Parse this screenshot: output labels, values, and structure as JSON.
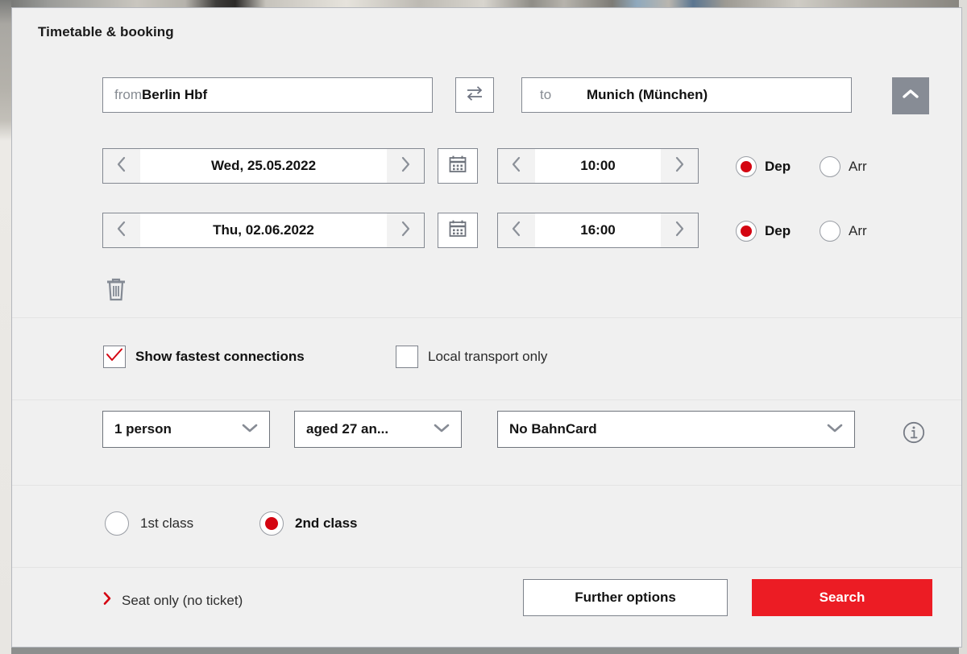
{
  "dialog": {
    "title": "Timetable & booking"
  },
  "journey": {
    "from": {
      "label": "from",
      "value": "Berlin Hbf",
      "name": "from-field"
    },
    "to": {
      "label": "to",
      "value": "Munich (München)",
      "name": "to-field"
    },
    "swap_icon": "swap-arrows-icon",
    "collapse_icon": "chevron-up-icon"
  },
  "legs": [
    {
      "date": "Wed, 25.05.2022",
      "time": "10:00",
      "calendar_icon": "calendar-icon",
      "prev_icon": "chevron-left-icon",
      "next_icon": "chevron-right-icon",
      "dep_label": "Dep",
      "arr_label": "Arr",
      "selected": "dep"
    },
    {
      "date": "Thu, 02.06.2022",
      "time": "16:00",
      "calendar_icon": "calendar-icon",
      "prev_icon": "chevron-left-icon",
      "next_icon": "chevron-right-icon",
      "dep_label": "Dep",
      "arr_label": "Arr",
      "selected": "dep"
    }
  ],
  "remove_leg": {
    "icon": "trash-icon"
  },
  "options": {
    "fastest": {
      "label": "Show fastest connections",
      "checked": true,
      "check_icon": "check-mark-icon"
    },
    "local": {
      "label": "Local transport only",
      "checked": false
    }
  },
  "travellers": {
    "persons": {
      "value": "1 person",
      "chevron": "chevron-down-icon"
    },
    "age": {
      "value": "aged 27 an...",
      "chevron": "chevron-down-icon"
    },
    "bahncard": {
      "value": "No BahnCard",
      "chevron": "chevron-down-icon"
    },
    "info_icon": "info-icon"
  },
  "travel_class": {
    "first": {
      "label": "1st class",
      "selected": false
    },
    "second": {
      "label": "2nd class",
      "selected": true
    }
  },
  "footer": {
    "seat_only": {
      "label": "Seat only (no ticket)",
      "chevron": "chevron-right-icon"
    },
    "further_options": "Further options",
    "search": "Search"
  },
  "colors": {
    "accent_red": "#d40511",
    "search_red": "#ec1c24",
    "panel_bg": "#f0f0f0",
    "grey_icon": "#7d828c"
  }
}
